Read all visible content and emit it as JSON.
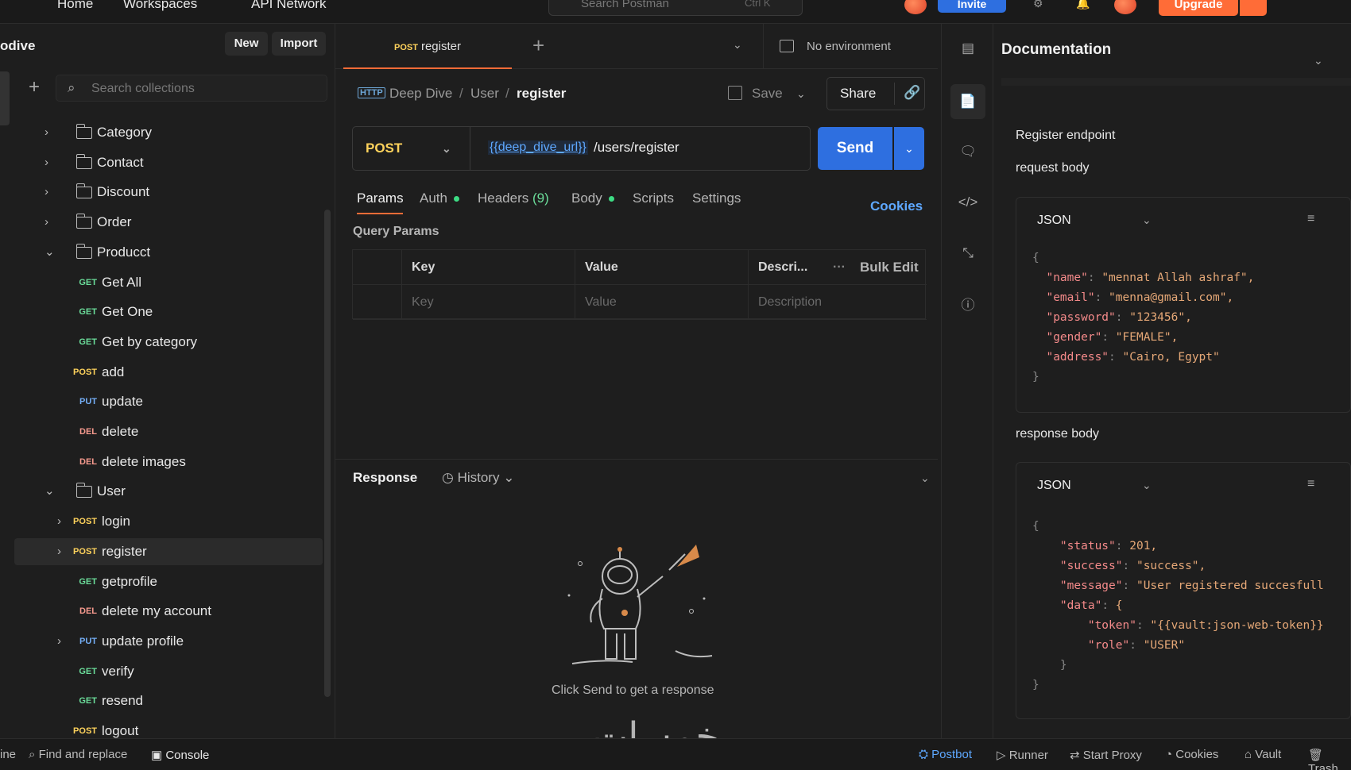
{
  "topbar": {
    "nav": [
      "Home",
      "Workspaces",
      "API Network"
    ],
    "search_placeholder": "Search Postman",
    "search_shortcut": "Ctrl K",
    "invite_label": "Invite",
    "upgrade_label": "Upgrade"
  },
  "sidebar": {
    "workspace_name": "odive",
    "new_label": "New",
    "import_label": "Import",
    "search_placeholder": "Search collections",
    "items": [
      {
        "type": "folder",
        "label": "Category",
        "expanded": false
      },
      {
        "type": "folder",
        "label": "Contact",
        "expanded": false
      },
      {
        "type": "folder",
        "label": "Discount",
        "expanded": false
      },
      {
        "type": "folder",
        "label": "Order",
        "expanded": false
      },
      {
        "type": "folder",
        "label": "Producct",
        "expanded": true
      },
      {
        "type": "request",
        "method": "GET",
        "label": "Get All"
      },
      {
        "type": "request",
        "method": "GET",
        "label": "Get One"
      },
      {
        "type": "request",
        "method": "GET",
        "label": "Get by category"
      },
      {
        "type": "request",
        "method": "POST",
        "label": "add"
      },
      {
        "type": "request",
        "method": "PUT",
        "label": "update"
      },
      {
        "type": "request",
        "method": "DEL",
        "label": "delete"
      },
      {
        "type": "request",
        "method": "DEL",
        "label": "delete images"
      },
      {
        "type": "folder",
        "label": "User",
        "expanded": true
      },
      {
        "type": "request",
        "method": "POST",
        "label": "login"
      },
      {
        "type": "request",
        "method": "POST",
        "label": "register",
        "selected": true
      },
      {
        "type": "request",
        "method": "GET",
        "label": "getprofile"
      },
      {
        "type": "request",
        "method": "DEL",
        "label": "delete my account"
      },
      {
        "type": "request",
        "method": "PUT",
        "label": "update profile"
      },
      {
        "type": "request",
        "method": "GET",
        "label": "verify"
      },
      {
        "type": "request",
        "method": "GET",
        "label": "resend"
      },
      {
        "type": "request",
        "method": "POST",
        "label": "logout"
      }
    ]
  },
  "tabs": {
    "active_method": "POST",
    "active_label": "register",
    "environment": "No environment"
  },
  "breadcrumb": {
    "parts": [
      "Deep Dive",
      "User",
      "register"
    ],
    "save_label": "Save",
    "share_label": "Share"
  },
  "request": {
    "method": "POST",
    "url_variable": "{{deep_dive_url}}",
    "url_path": " /users/register",
    "send_label": "Send",
    "tabs": [
      "Params",
      "Auth",
      "Headers",
      "Body",
      "Scripts",
      "Settings"
    ],
    "headers_count": "(9)",
    "cookies_label": "Cookies",
    "query_params_title": "Query Params",
    "columns": [
      "Key",
      "Value",
      "Descri...",
      "Bulk Edit"
    ],
    "placeholders": [
      "Key",
      "Value",
      "Description"
    ]
  },
  "response": {
    "title": "Response",
    "history_label": "History",
    "empty_message": "Click Send to get a response"
  },
  "documentation": {
    "title": "Documentation",
    "endpoint_text": "Register endpoint",
    "request_body_label": "request body",
    "response_body_label": "response body",
    "format": "JSON",
    "request_json": [
      {
        "key": "\"name\"",
        "value": "\"mennat Allah ashraf\","
      },
      {
        "key": "\"email\"",
        "value": "\"menna@gmail.com\","
      },
      {
        "key": "\"password\"",
        "value": "\"123456\","
      },
      {
        "key": "\"gender\"",
        "value": "\"FEMALE\","
      },
      {
        "key": "\"address\"",
        "value": "\"Cairo, Egypt\""
      }
    ],
    "response_json": [
      {
        "key": "\"status\"",
        "value": "201,"
      },
      {
        "key": "\"success\"",
        "value": "\"success\","
      },
      {
        "key": "\"message\"",
        "value": "\"User registered succesfull"
      },
      {
        "key": "\"data\"",
        "value": "{"
      },
      {
        "key": "\"token\"",
        "value": "\"{{vault:json-web-token}}"
      },
      {
        "key": "\"role\"",
        "value": "\"USER\""
      }
    ]
  },
  "statusbar": {
    "left": [
      "ine",
      "Find and replace",
      "Console"
    ],
    "right": [
      "Postbot",
      "Runner",
      "Start Proxy",
      "Cookies",
      "Vault",
      "Trash"
    ]
  },
  "watermark": "خمسات",
  "colors": {
    "accent": "#ff6c37",
    "send": "#2e6fe0",
    "get": "#6bdd9a",
    "post": "#ffd35c",
    "put": "#74aef6",
    "delete": "#f79a8e"
  }
}
